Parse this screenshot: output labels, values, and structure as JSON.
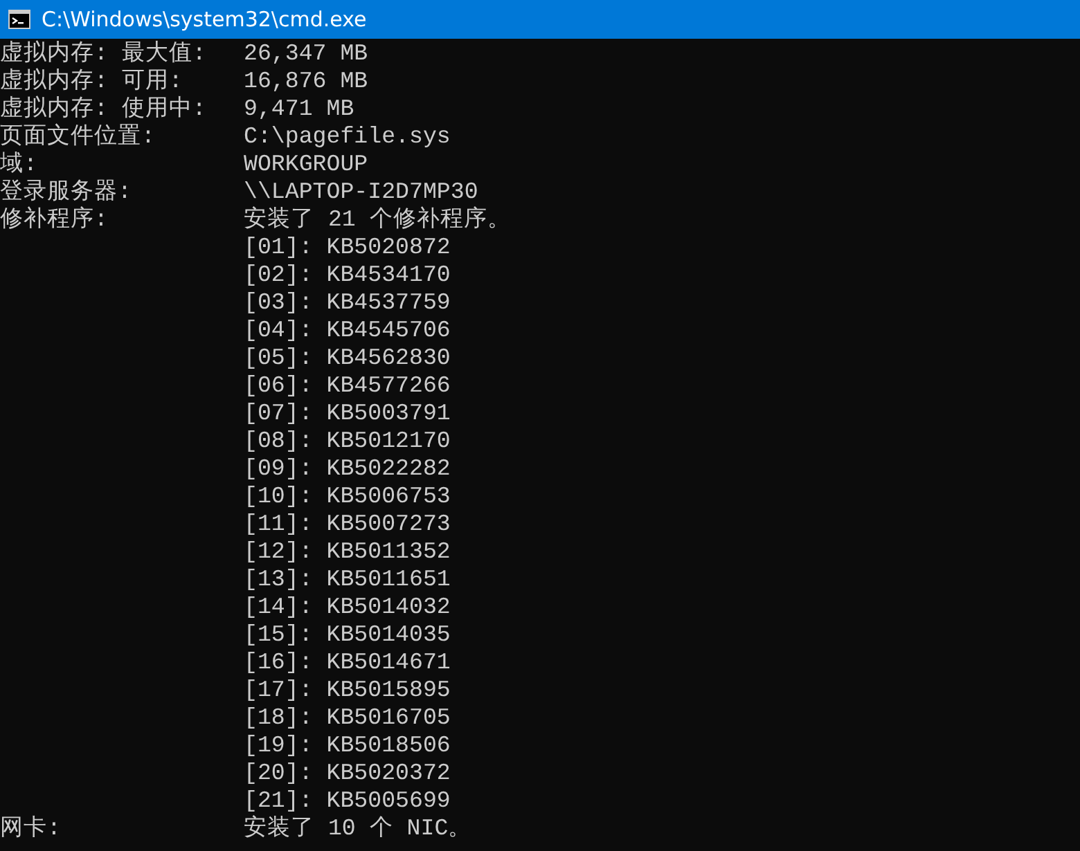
{
  "window": {
    "title": "C:\\Windows\\system32\\cmd.exe"
  },
  "lines": [
    {
      "label": "虚拟内存: 最大值:",
      "value": "26,347 MB"
    },
    {
      "label": "虚拟内存: 可用:",
      "value": "16,876 MB"
    },
    {
      "label": "虚拟内存: 使用中:",
      "value": "9,471 MB"
    },
    {
      "label": "页面文件位置:",
      "value": "C:\\pagefile.sys"
    },
    {
      "label": "域:",
      "value": "WORKGROUP"
    },
    {
      "label": "登录服务器:",
      "value": "\\\\LAPTOP-I2D7MP30"
    },
    {
      "label": "修补程序:",
      "value": "安装了 21 个修补程序。"
    },
    {
      "value": "[01]: KB5020872"
    },
    {
      "value": "[02]: KB4534170"
    },
    {
      "value": "[03]: KB4537759"
    },
    {
      "value": "[04]: KB4545706"
    },
    {
      "value": "[05]: KB4562830"
    },
    {
      "value": "[06]: KB4577266"
    },
    {
      "value": "[07]: KB5003791"
    },
    {
      "value": "[08]: KB5012170"
    },
    {
      "value": "[09]: KB5022282"
    },
    {
      "value": "[10]: KB5006753"
    },
    {
      "value": "[11]: KB5007273"
    },
    {
      "value": "[12]: KB5011352"
    },
    {
      "value": "[13]: KB5011651"
    },
    {
      "value": "[14]: KB5014032"
    },
    {
      "value": "[15]: KB5014035"
    },
    {
      "value": "[16]: KB5014671"
    },
    {
      "value": "[17]: KB5015895"
    },
    {
      "value": "[18]: KB5016705"
    },
    {
      "value": "[19]: KB5018506"
    },
    {
      "value": "[20]: KB5020372"
    },
    {
      "value": "[21]: KB5005699"
    },
    {
      "label": "网卡:",
      "value": "安装了 10 个 NIC。"
    }
  ]
}
